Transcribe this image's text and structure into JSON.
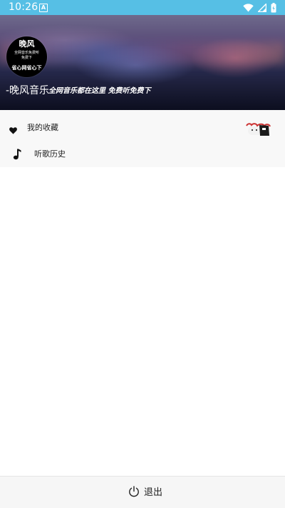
{
  "status_bar": {
    "time": "10:26",
    "app_icon_letter": "A",
    "icons": [
      "wifi-icon",
      "signal-icon",
      "battery-icon"
    ],
    "background_color": "#56bfe5"
  },
  "header": {
    "logo": {
      "title": "晚风",
      "sub1": "全网音乐免费听",
      "sub2": "免费下",
      "bottom": "省心网省心下"
    },
    "app_name": "-晚风音乐",
    "slogan": "全网音乐都在这里 免费听免费下"
  },
  "menu": {
    "items": [
      {
        "label": "我的收藏",
        "icon": "heart-icon"
      },
      {
        "label": "听歌历史",
        "icon": "music-note-icon"
      }
    ]
  },
  "bottom": {
    "logout_label": "退出",
    "logout_icon": "power-icon"
  }
}
